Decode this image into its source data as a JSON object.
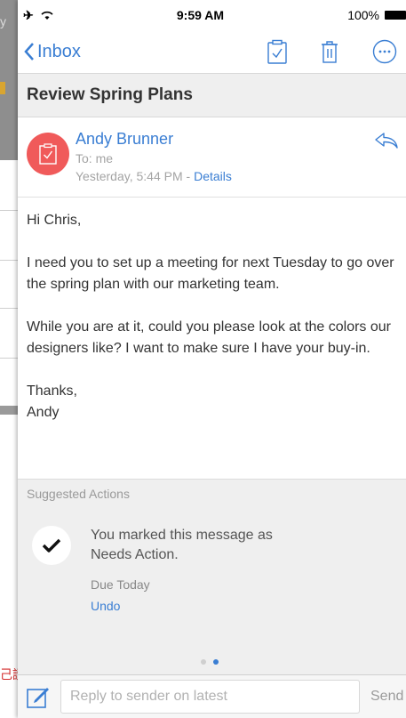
{
  "background": {
    "fragment_text": "y",
    "red_fragment": "己讀"
  },
  "status_bar": {
    "time": "9:59 AM",
    "battery": "100%"
  },
  "nav": {
    "back_label": "Inbox"
  },
  "message": {
    "subject": "Review Spring Plans",
    "sender": "Andy Brunner",
    "to": "To: me",
    "date": "Yesterday, 5:44 PM - ",
    "details_link": "Details",
    "body": [
      "Hi Chris,",
      "I need you to set up a meeting for next Tuesday to go over the spring plan with our marketing team.",
      "While you are at it, could you please look at the colors our designers like? I want to make sure I have your buy-in.",
      "Thanks,\nAndy"
    ]
  },
  "suggested_actions": {
    "title": "Suggested Actions",
    "status_text": "You marked this message as Needs Action.",
    "due": "Due Today",
    "undo": "Undo"
  },
  "composer": {
    "placeholder": "Reply to sender on latest",
    "send_label": "Send"
  },
  "colors": {
    "accent": "#3a7ed3",
    "avatar": "#f05a5a"
  }
}
